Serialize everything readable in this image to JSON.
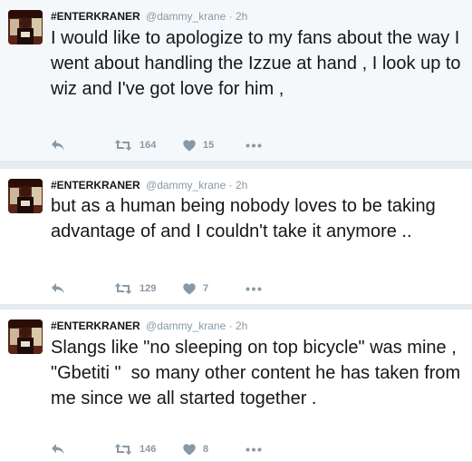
{
  "tweets": [
    {
      "name": "#ENTERKRANER",
      "handle": "@dammy_krane",
      "separator": "·",
      "time": "2h",
      "text": "I would like to apologize to my fans about the way I went about handling the Izzue at hand , I look up to wiz and I've got love for him ,",
      "retweets": "164",
      "likes": "15"
    },
    {
      "name": "#ENTERKRANER",
      "handle": "@dammy_krane",
      "separator": "·",
      "time": "2h",
      "text": "but as a human being nobody loves to be taking advantage of and I couldn't take it anymore ..",
      "retweets": "129",
      "likes": "7"
    },
    {
      "name": "#ENTERKRANER",
      "handle": "@dammy_krane",
      "separator": "·",
      "time": "2h",
      "text": "Slangs like \"no sleeping on top bicycle\" was mine , \"Gbetiti \"  so many other content he has taken from me since we all started together .",
      "retweets": "146",
      "likes": "8"
    }
  ],
  "icons": {
    "reply": "reply-icon",
    "retweet": "retweet-icon",
    "like": "heart-icon",
    "more": "more-dots-icon"
  },
  "colors": {
    "name": "#14171a",
    "muted": "#8899a6",
    "highlight_bg": "#f5f8fa",
    "divider": "#e1e8ed"
  }
}
